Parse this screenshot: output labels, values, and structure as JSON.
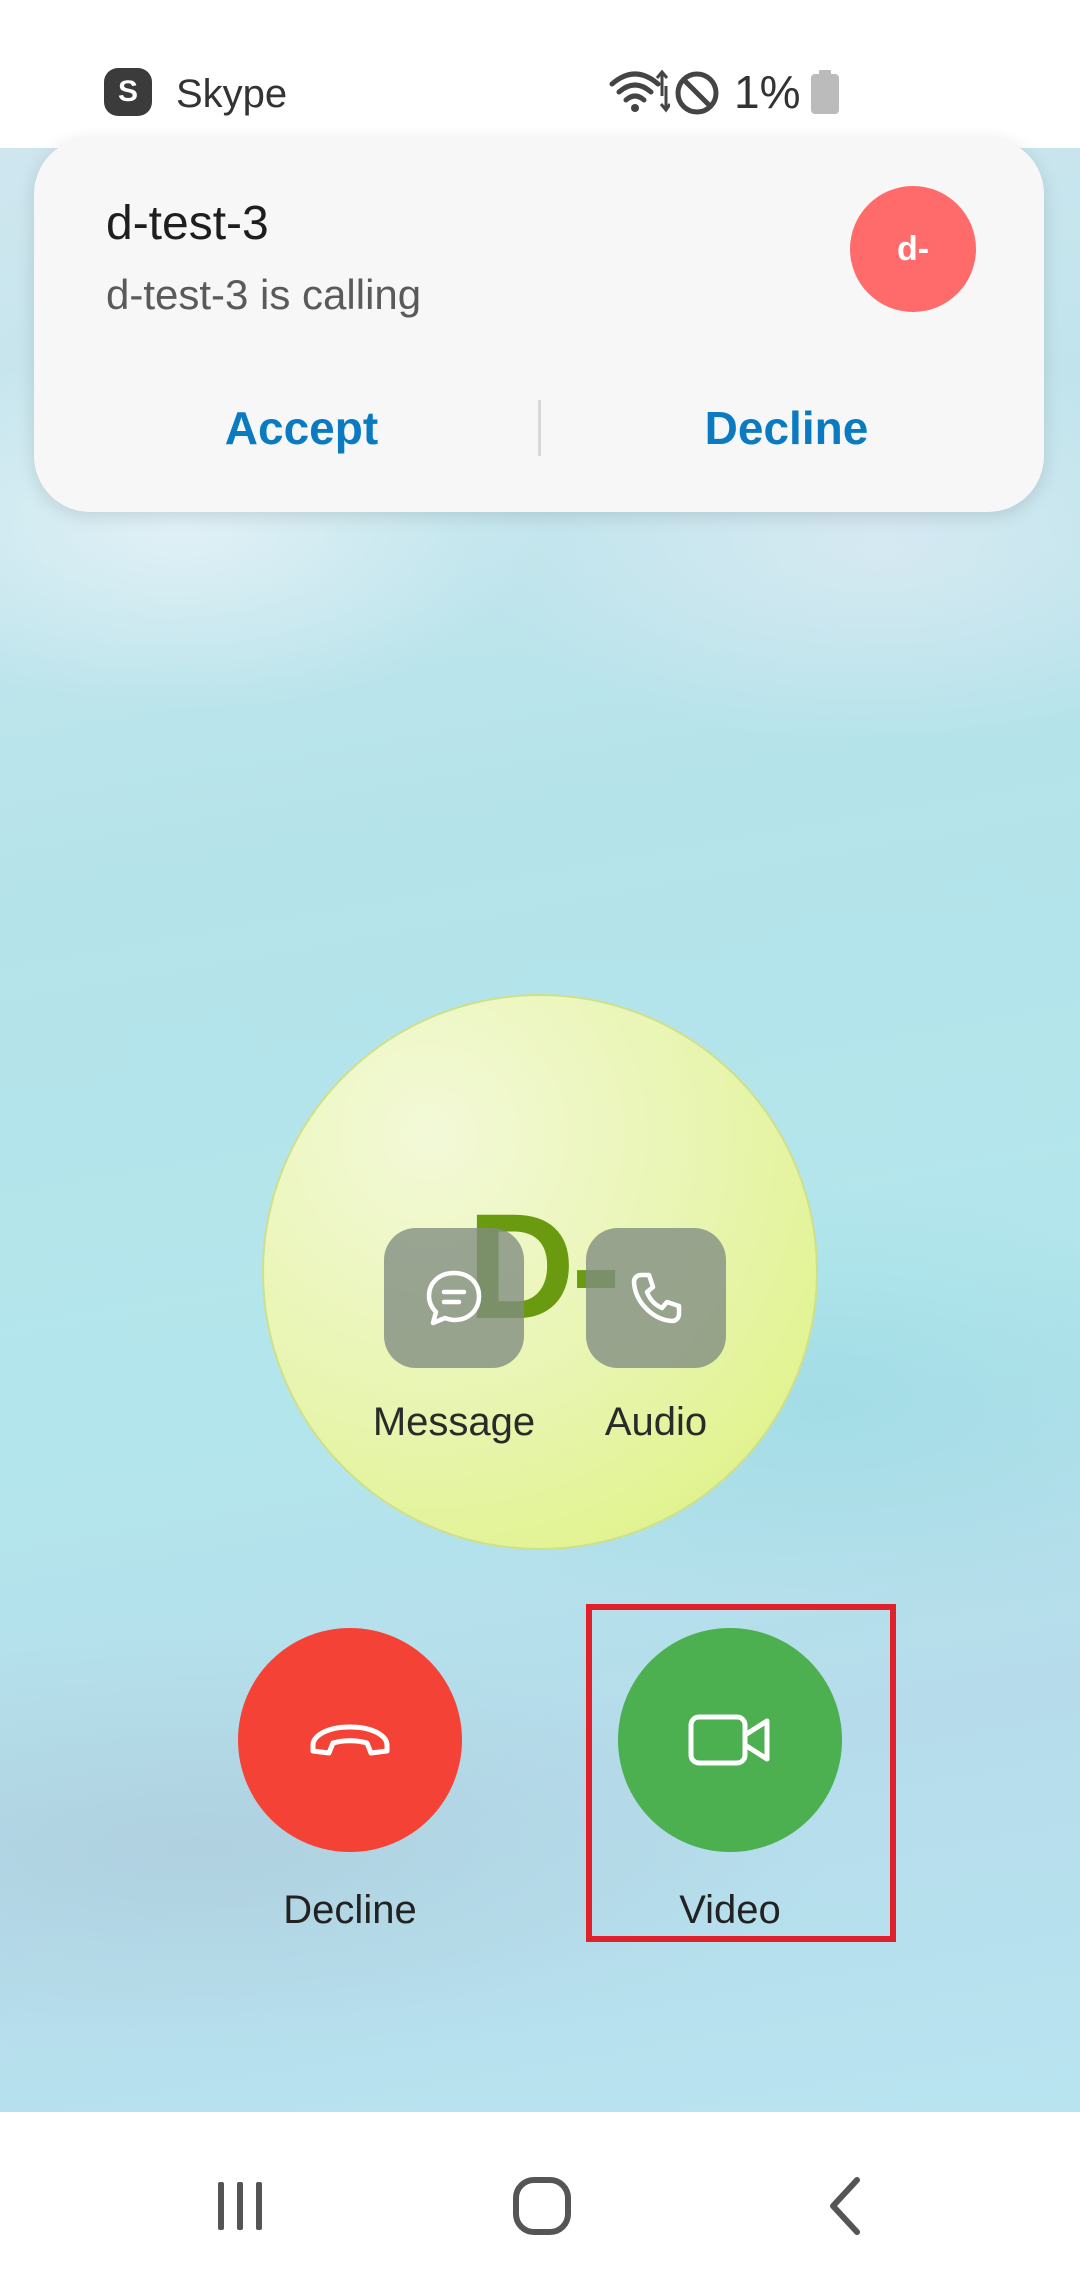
{
  "status_bar": {
    "app_icon_letter": "S",
    "app_name": "Skype",
    "battery_text": "1%"
  },
  "notification": {
    "title": "d-test-3",
    "subtitle": "d-test-3 is calling",
    "avatar_initials": "d-",
    "accept_label": "Accept",
    "decline_label": "Decline",
    "avatar_color": "#ff6b6b",
    "action_color": "#0b7bc1"
  },
  "caller": {
    "initials": "D-",
    "message_label": "Message",
    "audio_label": "Audio"
  },
  "call_actions": {
    "decline_label": "Decline",
    "video_label": "Video",
    "decline_color": "#f44336",
    "video_color": "#4caf50",
    "highlight_color": "#e0202a"
  },
  "icons": {
    "status": [
      "skype-icon",
      "wifi-icon",
      "do-not-disturb-icon",
      "battery-icon"
    ],
    "caller": [
      "message-icon",
      "phone-icon"
    ],
    "call": [
      "hang-up-icon",
      "video-camera-icon"
    ],
    "nav": [
      "recents-icon",
      "home-icon",
      "back-icon"
    ]
  }
}
